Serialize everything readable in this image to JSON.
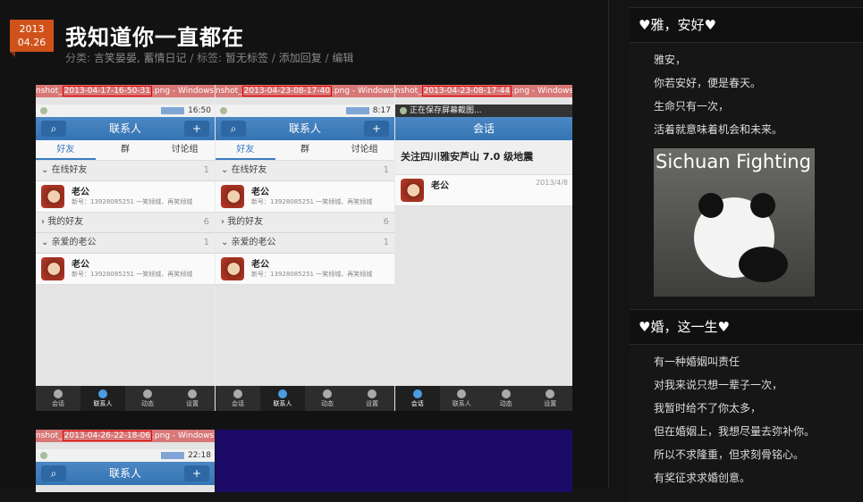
{
  "post": {
    "date_year": "2013",
    "date_day": "04.26",
    "title": "我知道你一直都在",
    "meta": {
      "category_prefix": "分类: ",
      "categories": "言笑晏晏, 蓄情日记",
      "tag_prefix": " / 标签: ",
      "tags": "暂无标签",
      "sep1": " / ",
      "reply": "添加回复",
      "sep2": " / ",
      "edit": "编辑"
    }
  },
  "screenshot": {
    "phones": [
      {
        "titlebar_prefix": "nshot_",
        "timestamp": "2013-04-17-16-50-31",
        "titlebar_suffix": ".png - Windows 照片查",
        "time": "16:50",
        "header": "联系人",
        "tabs": [
          "好友",
          "群",
          "讨论组"
        ],
        "groups": [
          {
            "name": "在线好友",
            "count": "1"
          },
          {
            "name": "我的好友",
            "count": "6"
          },
          {
            "name": "亲爱的老公",
            "count": "1"
          }
        ],
        "contact_name": "老公",
        "contact_sig": "新号：13928085251 一笑倾城、再笑倾城",
        "nav": [
          "会话",
          "联系人",
          "动态",
          "设置"
        ]
      },
      {
        "titlebar_prefix": "nshot_",
        "timestamp": "2013-04-23-08-17-40",
        "titlebar_suffix": ".png - Windows 照片查",
        "time": "8:17",
        "header": "联系人",
        "tabs": [
          "好友",
          "群",
          "讨论组"
        ],
        "groups": [
          {
            "name": "在线好友",
            "count": "1"
          },
          {
            "name": "我的好友",
            "count": "6"
          },
          {
            "name": "亲爱的老公",
            "count": "1"
          }
        ],
        "contact_name": "老公",
        "contact_sig": "新号：13928085251 一笑倾城、再笑倾城",
        "nav": [
          "会话",
          "联系人",
          "动态",
          "设置"
        ]
      },
      {
        "titlebar_prefix": "nshot_",
        "timestamp": "2013-04-23-08-17-44",
        "titlebar_suffix": ".png - Windows 照片查",
        "status_text": "正在保存屏幕截图...",
        "header": "会话",
        "banner": "关注四川雅安芦山 7.0 级地震",
        "contact_name": "老公",
        "contact_time": "2013/4/8",
        "nav": [
          "会话",
          "联系人",
          "动态",
          "设置"
        ]
      }
    ],
    "second": {
      "titlebar_prefix": "nshot_",
      "timestamp": "2013-04-26-22-18-06",
      "titlebar_suffix": ".png - Windows 照片查",
      "time": "22:18",
      "header": "联系人"
    }
  },
  "sidebar": {
    "widget1": {
      "title": "♥雅，安好♥",
      "lines": [
        "雅安，",
        "你若安好，便是春天。",
        "生命只有一次，",
        "活着就意味着机会和未来。"
      ],
      "image_caption": "Sichuan Fighting"
    },
    "widget2": {
      "title": "♥婚，这一生♥",
      "lines": [
        "有一种婚姻叫责任",
        "对我来说只想一辈子一次，",
        "我暂时给不了你太多，",
        "但在婚姻上，我想尽量去弥补你。",
        "所以不求隆重，但求刻骨铭心。",
        "有奖征求求婚创意。"
      ]
    }
  }
}
